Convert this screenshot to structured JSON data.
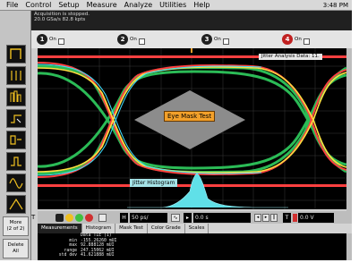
{
  "menu": {
    "items": [
      "File",
      "Control",
      "Setup",
      "Measure",
      "Analyze",
      "Utilities",
      "Help"
    ],
    "clock": "3:48 PM"
  },
  "status": {
    "line1": "Acquisition is stopped.",
    "line2": "20.0 GSa/s   82.8 kpts"
  },
  "channels": [
    {
      "number": "1",
      "state": "On",
      "color": "#f0c020"
    },
    {
      "number": "2",
      "state": "On",
      "color": "#40c040"
    },
    {
      "number": "3",
      "state": "On",
      "color": "#5080ff"
    },
    {
      "number": "4",
      "state": "On",
      "color": "#e03030"
    }
  ],
  "toolbar": {
    "more_label": "More",
    "more_sub": "(2 of 2)",
    "delete_label": "Delete",
    "delete_sub": "All",
    "tools": [
      "zoom-tool-icon",
      "marker-tool-icon",
      "histogram-tool-icon",
      "measure-tool-icon",
      "mask-tool-icon",
      "edge-tool-icon",
      "waveform-tool-icon",
      "jitter-tool-icon"
    ]
  },
  "screen": {
    "analysis_tag": "Jitter Analysis Data: 11.",
    "mask_label": "Eye Mask Test",
    "histogram_label": "Jitter Histogram"
  },
  "controls": {
    "t_marker": "T",
    "timebase": "50 ps/",
    "delay": "0.0 s",
    "trig_level": "0.0 V",
    "trig_tag": "T"
  },
  "tabs": [
    "Measurements",
    "Histogram",
    "Mask Test",
    "Color Grade",
    "Scales"
  ],
  "measurements": {
    "title": "Data TIE (1)",
    "rows": [
      {
        "label": "min",
        "value": "-155.26260 mUI"
      },
      {
        "label": "max",
        "value": "92.888128 mUI"
      },
      {
        "label": "range",
        "value": "247.15062 mUI"
      },
      {
        "label": "std dev",
        "value": "41.621888 mUI"
      }
    ]
  },
  "colors": {
    "screen_bg": "#000000",
    "mask_fill": "#8c8c8c",
    "trace_red": "#ff4040",
    "trace_yellow": "#ffe040",
    "trace_green": "#30d060",
    "trace_cyan": "#40e0ff",
    "histogram": "#60e0e8",
    "mask_label_bg": "#f2a02a"
  }
}
